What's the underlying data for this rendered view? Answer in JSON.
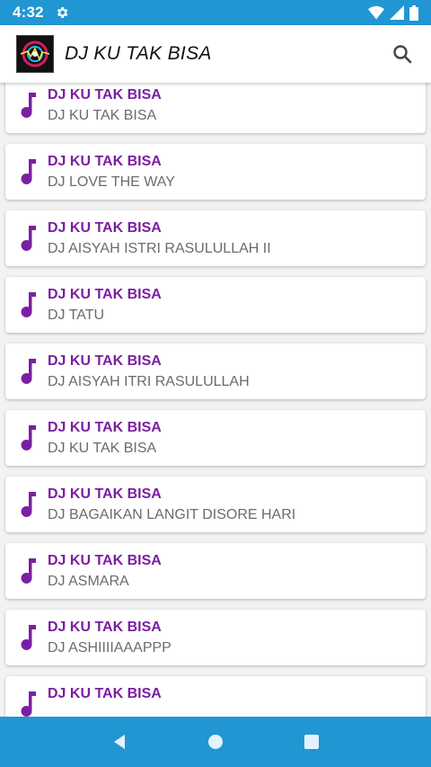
{
  "status_bar": {
    "time": "4:32",
    "icons": [
      "settings-icon",
      "wifi-icon",
      "signal-icon",
      "battery-icon"
    ],
    "color": "#2196d3"
  },
  "app_bar": {
    "title": "DJ KU TAK BISA",
    "logo_icon": "app-logo-icon",
    "search_icon": "search-icon"
  },
  "list": {
    "accent_color": "#7b1fa2",
    "items": [
      {
        "title": "DJ KU TAK BISA",
        "subtitle": "DJ KU TAK BISA"
      },
      {
        "title": "DJ KU TAK BISA",
        "subtitle": "DJ LOVE THE WAY"
      },
      {
        "title": "DJ KU TAK BISA",
        "subtitle": "DJ AISYAH ISTRI RASULULLAH II"
      },
      {
        "title": "DJ KU TAK BISA",
        "subtitle": "DJ TATU"
      },
      {
        "title": "DJ KU TAK BISA",
        "subtitle": "DJ AISYAH ITRI RASULULLAH"
      },
      {
        "title": "DJ KU TAK BISA",
        "subtitle": "DJ KU TAK BISA"
      },
      {
        "title": "DJ KU TAK BISA",
        "subtitle": "DJ BAGAIKAN LANGIT DISORE HARI"
      },
      {
        "title": "DJ KU TAK BISA",
        "subtitle": "DJ ASMARA"
      },
      {
        "title": "DJ KU TAK BISA",
        "subtitle": "DJ ASHIIIIAAAPPP"
      },
      {
        "title": "DJ KU TAK BISA",
        "subtitle": ""
      }
    ]
  },
  "nav_bar": {
    "icons": [
      "back-icon",
      "home-icon",
      "recents-icon"
    ],
    "color": "#2196d3"
  }
}
